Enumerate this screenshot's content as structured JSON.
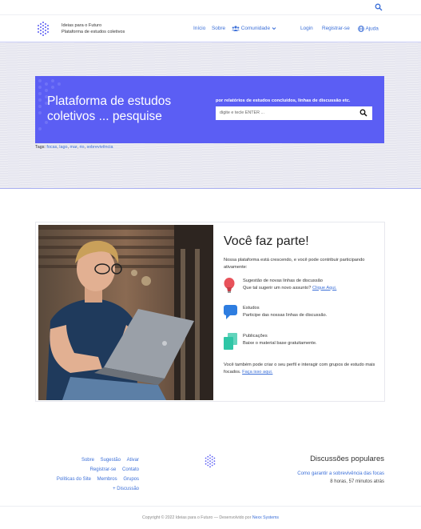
{
  "brand": {
    "name": "Ideias para o Futuro",
    "tagline": "Plataforma de estudos coletivos"
  },
  "nav": {
    "home": "Início",
    "about": "Sobre",
    "community": "Comunidade",
    "login": "Login",
    "register": "Registrar-se",
    "help": "Ajuda"
  },
  "hero": {
    "title_line1": "Plataforma de estudos",
    "title_line2": "coletivos ... pesquise",
    "search_hint": "por relatórios de estudos concluídos, linhas de discussão etc.",
    "search_placeholder": "digite e tecle ENTER ...",
    "tags_label": "Tags:",
    "tags": [
      "focas",
      "lago",
      "mar",
      "rio",
      "sobrevivência"
    ]
  },
  "card": {
    "title": "Você faz parte!",
    "intro": "Nossa plataforma está crescendo, e você pode contribuir participando ativamente:",
    "features": [
      {
        "icon": "lightbulb-icon",
        "title": "Sugestão de novas linhas de discussão",
        "text": "Que tal sugerir um novo assunto?",
        "link": "Clique Aqui."
      },
      {
        "icon": "chat-bubble-icon",
        "title": "Estudos",
        "text": "Participe das nossas linhas de discussão.",
        "link": ""
      },
      {
        "icon": "documents-icon",
        "title": "Publicações",
        "text": "Baixe o material base gratuitamente.",
        "link": ""
      }
    ],
    "outro": "Você também pode criar o seu perfil e interagir com grupos de estudo mais focados.",
    "outro_link": "Faça isso aqui."
  },
  "footer": {
    "links_row1": [
      "Sobre",
      "Sugestão",
      "Ativar"
    ],
    "links_row2": [
      "Registrar-se",
      "Contato"
    ],
    "links_row3": [
      "Políticas do Site",
      "Membros",
      "Grupos"
    ],
    "links_row4": [
      "+ Discussão"
    ],
    "popular_title": "Discussões populares",
    "popular_link": "Como garantir a sobrevivência das focas",
    "popular_time": "8 horas, 57 minutos atrás",
    "copyright": "Copyright © 2022 Ideias para o Futuro  —  Desenvolvido por",
    "developer": "Nexx Systems"
  },
  "colors": {
    "accent": "#5b5ef4",
    "link": "#3b6fd8",
    "bulb": "#e8525a",
    "chat": "#2e7de0",
    "docs": "#2fc6a6"
  }
}
